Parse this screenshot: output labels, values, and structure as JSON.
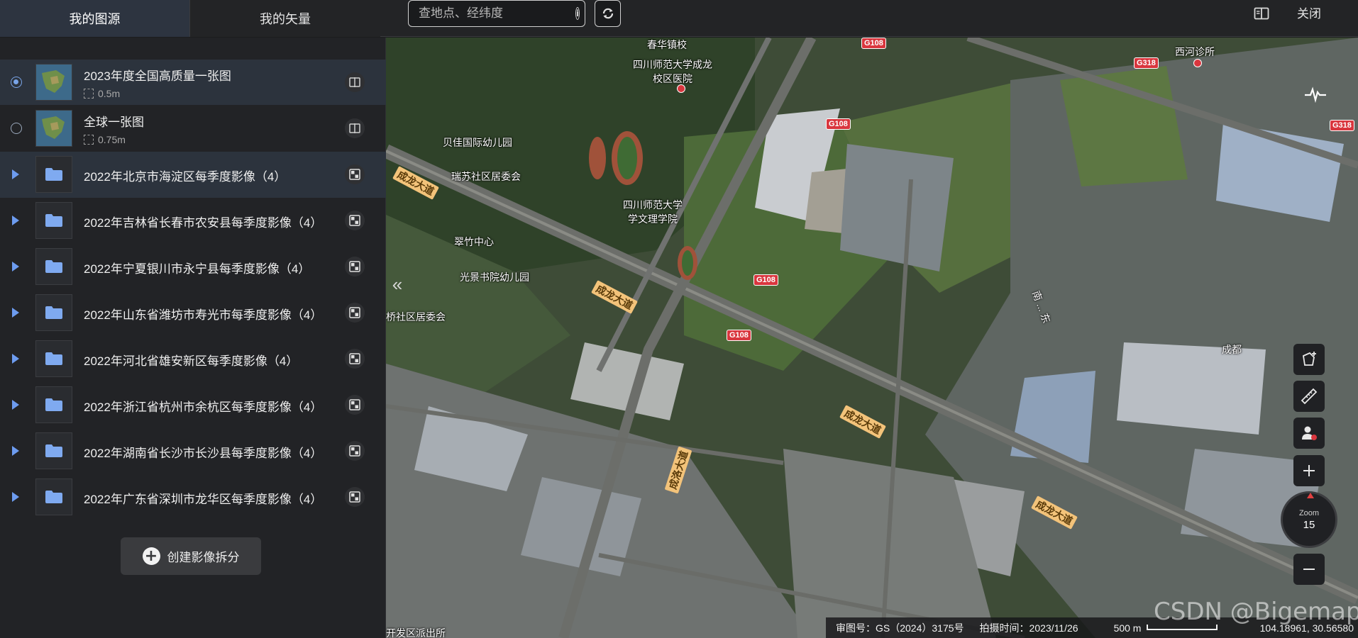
{
  "tabs": [
    {
      "label": "我的图源",
      "active": true
    },
    {
      "label": "我的矢量",
      "active": false
    }
  ],
  "search": {
    "placeholder": "查地点、经纬度"
  },
  "header": {
    "close_label": "关闭"
  },
  "sources": [
    {
      "title": "2023年度全国高质量一张图",
      "resolution": "0.5m",
      "selected": true
    },
    {
      "title": "全球一张图",
      "resolution": "0.75m",
      "selected": false
    }
  ],
  "folders": [
    {
      "title": "2022年北京市海淀区每季度影像（4）"
    },
    {
      "title": "2022年吉林省长春市农安县每季度影像（4）"
    },
    {
      "title": "2022年宁夏银川市永宁县每季度影像（4）"
    },
    {
      "title": "2022年山东省潍坊市寿光市每季度影像（4）"
    },
    {
      "title": "2022年河北省雄安新区每季度影像（4）"
    },
    {
      "title": "2022年浙江省杭州市余杭区每季度影像（4）"
    },
    {
      "title": "2022年湖南省长沙市长沙县每季度影像（4）"
    },
    {
      "title": "2022年广东省深圳市龙华区每季度影像（4）"
    }
  ],
  "create_button": {
    "label": "创建影像拆分"
  },
  "map": {
    "labels": {
      "school_north": "春华镇校",
      "university": "四川师范大学成龙\n校区医院",
      "kindergarten1": "贝佳国际幼儿园",
      "community1": "瑞苏社区居委会",
      "university2": "四川师范大学\n学文理学院",
      "clinic": "西河诊所",
      "community2": "翠竹中心",
      "kindergarten2": "光景书院幼儿园",
      "community3": "桥社区居委会",
      "road1": "成龙大道",
      "road2": "成龙大道",
      "road3": "成龙大道",
      "road4": "成龙大道",
      "road5": "成洛大道",
      "g108a": "G108",
      "g108b": "G108",
      "g108c": "G108",
      "g108d": "G108",
      "g318a": "G318",
      "g318b": "G318",
      "street1": "南 ... 东",
      "east": "成都",
      "bottom_left": "开发区派出所"
    },
    "zoom": {
      "label": "Zoom",
      "value": "15"
    },
    "status": {
      "review_no": "审图号：GS（2024）3175号",
      "capture_time": "拍摄时间：2023/11/26",
      "scale": "500 m",
      "coords": "104.18961, 30.56580"
    },
    "watermark": "CSDN @Bigemap"
  },
  "colors": {
    "accent": "#6d9cf0",
    "selected_row": "#2c333d",
    "sidebar_bg": "#222326",
    "badge_red": "#d9363e"
  }
}
